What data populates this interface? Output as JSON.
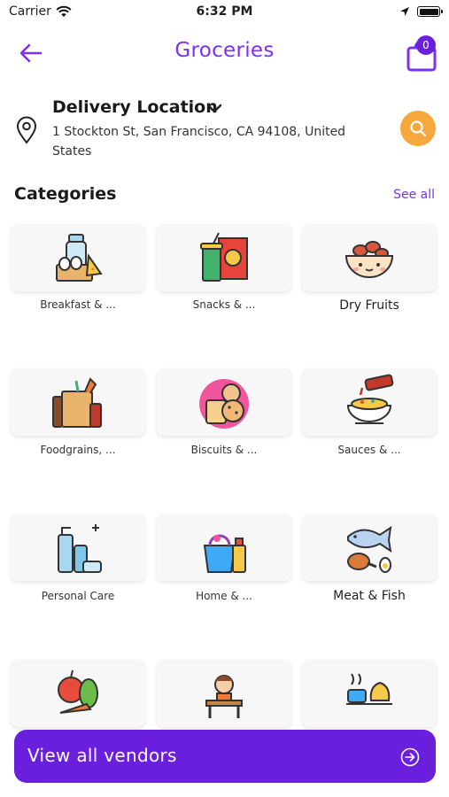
{
  "status_bar": {
    "carrier": "Carrier",
    "time": "6:32 PM"
  },
  "header": {
    "title": "Groceries",
    "cart_count": "0"
  },
  "location": {
    "title": "Delivery Location",
    "address": "1 Stockton St, San Francisco, CA  94108, United States"
  },
  "categories": {
    "heading": "Categories",
    "see_all": "See all",
    "items": [
      {
        "label": "Breakfast & ...",
        "icon": "breakfast-icon"
      },
      {
        "label": "Snacks & ...",
        "icon": "snacks-icon"
      },
      {
        "label": "Dry Fruits",
        "icon": "dry-fruits-icon"
      },
      {
        "label": "Foodgrains, ...",
        "icon": "foodgrains-icon"
      },
      {
        "label": "Biscuits & ...",
        "icon": "biscuits-icon"
      },
      {
        "label": "Sauces & ...",
        "icon": "sauces-icon"
      },
      {
        "label": "Personal Care",
        "icon": "personal-care-icon"
      },
      {
        "label": "Home & ...",
        "icon": "home-care-icon"
      },
      {
        "label": "Meat & Fish",
        "icon": "meat-fish-icon"
      },
      {
        "icon": "fruits-vegetables-icon"
      },
      {
        "icon": "baby-care-icon"
      },
      {
        "icon": "beverages-icon"
      }
    ]
  },
  "footer": {
    "view_vendors": "View all vendors"
  },
  "colors": {
    "accent": "#7b2ff7",
    "button": "#6a1fdc",
    "search": "#f6a83c"
  }
}
